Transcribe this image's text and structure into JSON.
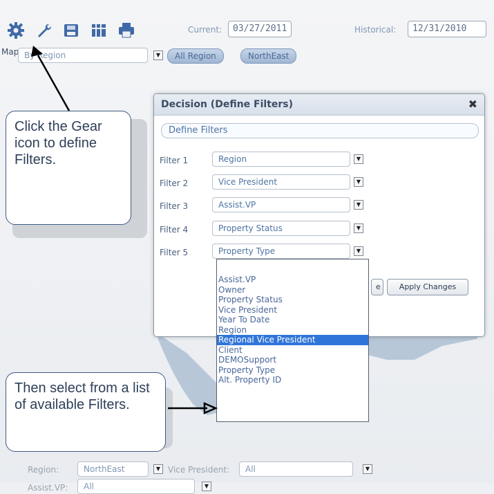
{
  "toolbar": {
    "icons": [
      "gear-icon",
      "wrench-icon",
      "save-icon",
      "columns-icon",
      "print-icon"
    ]
  },
  "dates": {
    "current_label": "Current:",
    "current_value": "03/27/2011",
    "historical_label": "Historical:",
    "historical_value": "12/31/2010"
  },
  "map_controls": {
    "label": "Map",
    "selected": "By Region",
    "breadcrumb": [
      "All Region",
      "NorthEast"
    ]
  },
  "dialog": {
    "title": "Decision (Define Filters)",
    "tab": "Define Filters",
    "filters": [
      {
        "label": "Filter 1",
        "value": "Region"
      },
      {
        "label": "Filter 2",
        "value": "Vice President"
      },
      {
        "label": "Filter 3",
        "value": "Assist.VP"
      },
      {
        "label": "Filter 4",
        "value": "Property Status"
      },
      {
        "label": "Filter 5",
        "value": "Property Type"
      }
    ],
    "buttons": {
      "partial": "e",
      "apply": "Apply Changes"
    }
  },
  "dropdown": {
    "options": [
      "",
      "Assist.VP",
      "Owner",
      "Property Status",
      "Vice President",
      "Year To Date",
      "Region",
      "Regional Vice President",
      "Client",
      "DEMOSupport",
      "Property Type",
      "Alt. Property ID"
    ],
    "selected": "Regional Vice President"
  },
  "callouts": {
    "top": "Click the Gear icon to define Filters.",
    "bottom": "Then select from a list of available Filters."
  },
  "bottom": {
    "region_label": "Region:",
    "region_value": "NorthEast",
    "vp_label": "Vice President:",
    "vp_value": "All",
    "assist_label": "Assist.VP:",
    "assist_value": "All"
  }
}
